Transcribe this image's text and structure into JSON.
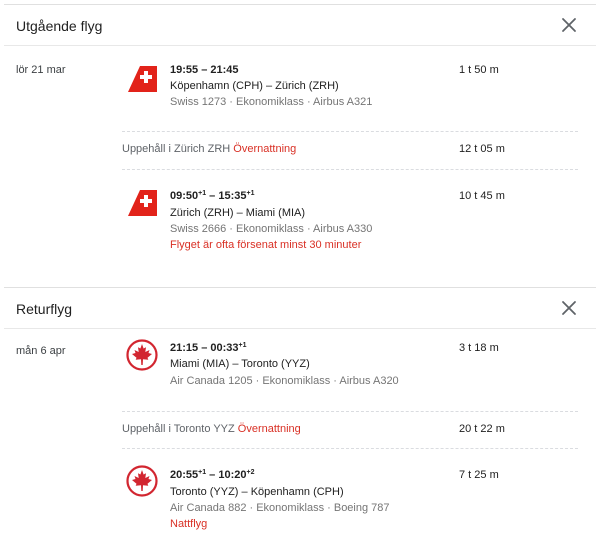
{
  "colors": {
    "swiss_red": "#e2231a",
    "aircanada_red": "#d22630",
    "warning_red": "#d93025"
  },
  "outbound": {
    "title": "Utgående flyg",
    "close_icon": "close-icon",
    "date": "lör 21 mar",
    "legs": [
      {
        "airline_logo": "swiss-logo",
        "dep": "19:55",
        "dep_sup": "",
        "sep": " – ",
        "arr": "21:45",
        "arr_sup": "",
        "route": "Köpenhamn (CPH) – Zürich (ZRH)",
        "meta": "Swiss 1273 · Ekonomiklass · Airbus A321",
        "duration": "1 t 50 m"
      },
      {
        "airline_logo": "swiss-logo",
        "dep": "09:50",
        "dep_sup": "+1",
        "sep": " – ",
        "arr": "15:35",
        "arr_sup": "+1",
        "route": "Zürich (ZRH) – Miami (MIA)",
        "meta": "Swiss 2666 · Ekonomiklass · Airbus A330",
        "warning": "Flyget är ofta försenat minst 30 minuter",
        "duration": "10 t 45 m"
      }
    ],
    "layover": {
      "text": "Uppehåll i Zürich ZRH",
      "flag": "Övernattning",
      "duration": "12 t 05 m"
    }
  },
  "return": {
    "title": "Returflyg",
    "close_icon": "close-icon",
    "date": "mån 6 apr",
    "legs": [
      {
        "airline_logo": "air-canada-logo",
        "dep": "21:15",
        "dep_sup": "",
        "sep": " – ",
        "arr": "00:33",
        "arr_sup": "+1",
        "route": "Miami (MIA) – Toronto (YYZ)",
        "meta": "Air Canada 1205 · Ekonomiklass · Airbus A320",
        "duration": "3 t 18 m"
      },
      {
        "airline_logo": "air-canada-logo",
        "dep": "20:55",
        "dep_sup": "+1",
        "sep": " – ",
        "arr": "10:20",
        "arr_sup": "+2",
        "route": "Toronto (YYZ) – Köpenhamn (CPH)",
        "meta": "Air Canada 882 · Ekonomiklass · Boeing 787",
        "warning": "Nattflyg",
        "duration": "7 t 25 m"
      }
    ],
    "layover": {
      "text": "Uppehåll i Toronto YYZ",
      "flag": "Övernattning",
      "duration": "20 t 22 m"
    }
  }
}
